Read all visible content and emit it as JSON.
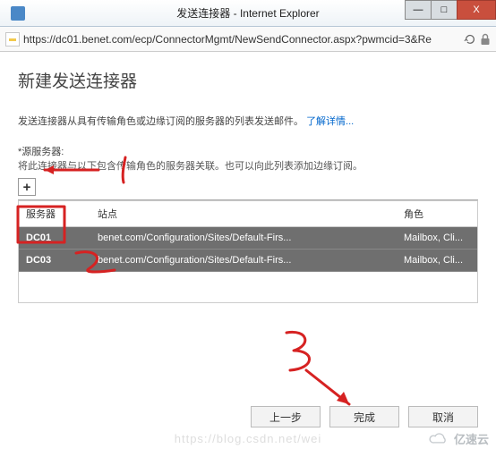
{
  "window": {
    "title": "发送连接器 - Internet Explorer",
    "min_icon": "—",
    "max_icon": "□",
    "close_icon": "X"
  },
  "addressbar": {
    "url": "https://dc01.benet.com/ecp/ConnectorMgmt/NewSendConnector.aspx?pwmcid=3&Re"
  },
  "page": {
    "heading": "新建发送连接器",
    "intro_text": "发送连接器从具有传输角色或边缘订阅的服务器的列表发送邮件。",
    "learn_more": "了解详情...",
    "src_label": "*源服务器:",
    "src_hint": "将此连接器与以下包含传输角色的服务器关联。也可以向此列表添加边缘订阅。"
  },
  "toolbar": {
    "add_symbol": "+"
  },
  "grid": {
    "columns": {
      "server": "服务器",
      "site": "站点",
      "role": "角色"
    },
    "rows": [
      {
        "server": "DC01",
        "site": "benet.com/Configuration/Sites/Default-Firs...",
        "role": "Mailbox, Cli..."
      },
      {
        "server": "DC03",
        "site": "benet.com/Configuration/Sites/Default-Firs...",
        "role": "Mailbox, Cli..."
      }
    ]
  },
  "buttons": {
    "back": "上一步",
    "finish": "完成",
    "cancel": "取消"
  },
  "annotations": {
    "num1": "1",
    "num2": "2",
    "num3": "3"
  },
  "watermark": "https://blog.csdn.net/wei",
  "brand": "亿速云"
}
